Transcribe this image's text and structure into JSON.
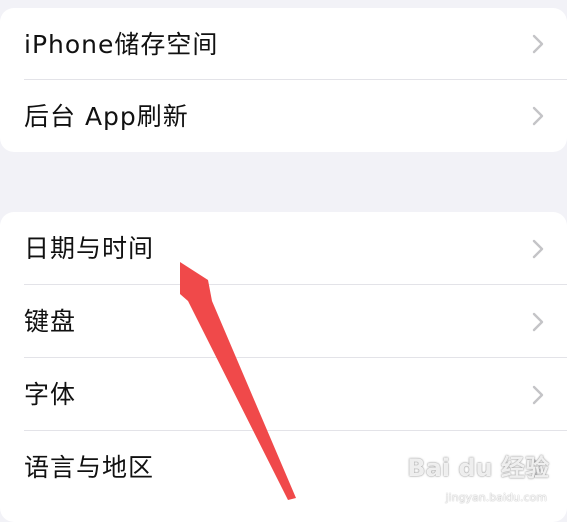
{
  "group_storage": {
    "items": [
      {
        "label": "iPhone储存空间"
      },
      {
        "label": "后台 App刷新"
      }
    ]
  },
  "group_general": {
    "items": [
      {
        "label": "日期与时间"
      },
      {
        "label": "键盘"
      },
      {
        "label": "字体"
      },
      {
        "label": "语言与地区"
      }
    ]
  },
  "watermark": {
    "logo": "Bai du 经验",
    "url": "jingyan.baidu.com"
  },
  "colors": {
    "background": "#f2f2f7",
    "cell": "#ffffff",
    "chevron": "#c4c4c7",
    "arrow": "#f0494a"
  },
  "icons": {
    "chevron": "chevron-right-icon",
    "pointer": "red-arrow-pointer"
  }
}
